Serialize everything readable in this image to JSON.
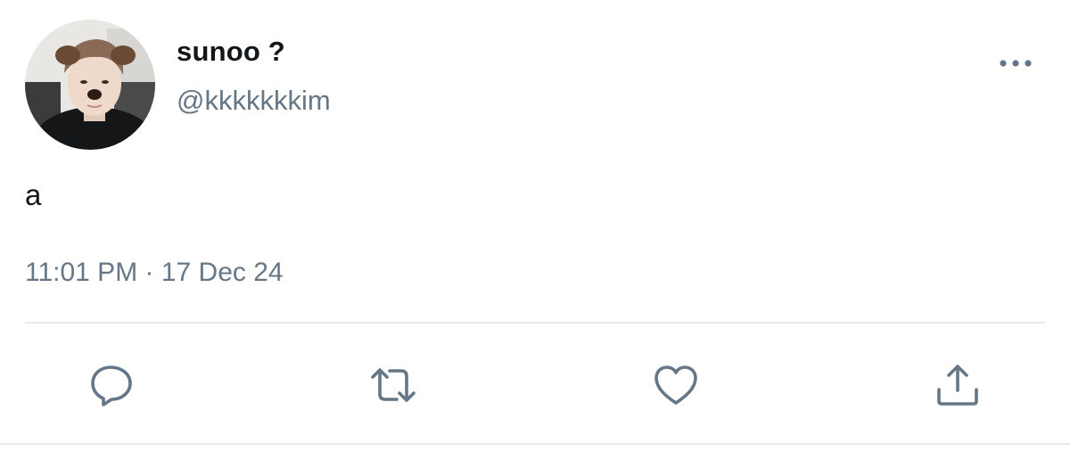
{
  "tweet": {
    "display_name": "sunoo ?",
    "handle": "@kkkkkkkim",
    "text": "a",
    "timestamp": "11:01 PM · 17 Dec 24"
  },
  "icons": {
    "more": "more-horizontal-icon",
    "reply": "reply-icon",
    "retweet": "retweet-icon",
    "like": "heart-icon",
    "share": "share-icon"
  },
  "colors": {
    "text_primary": "#14171a",
    "text_secondary": "#657786",
    "icon": "#657786",
    "divider": "#e6ecf0"
  }
}
